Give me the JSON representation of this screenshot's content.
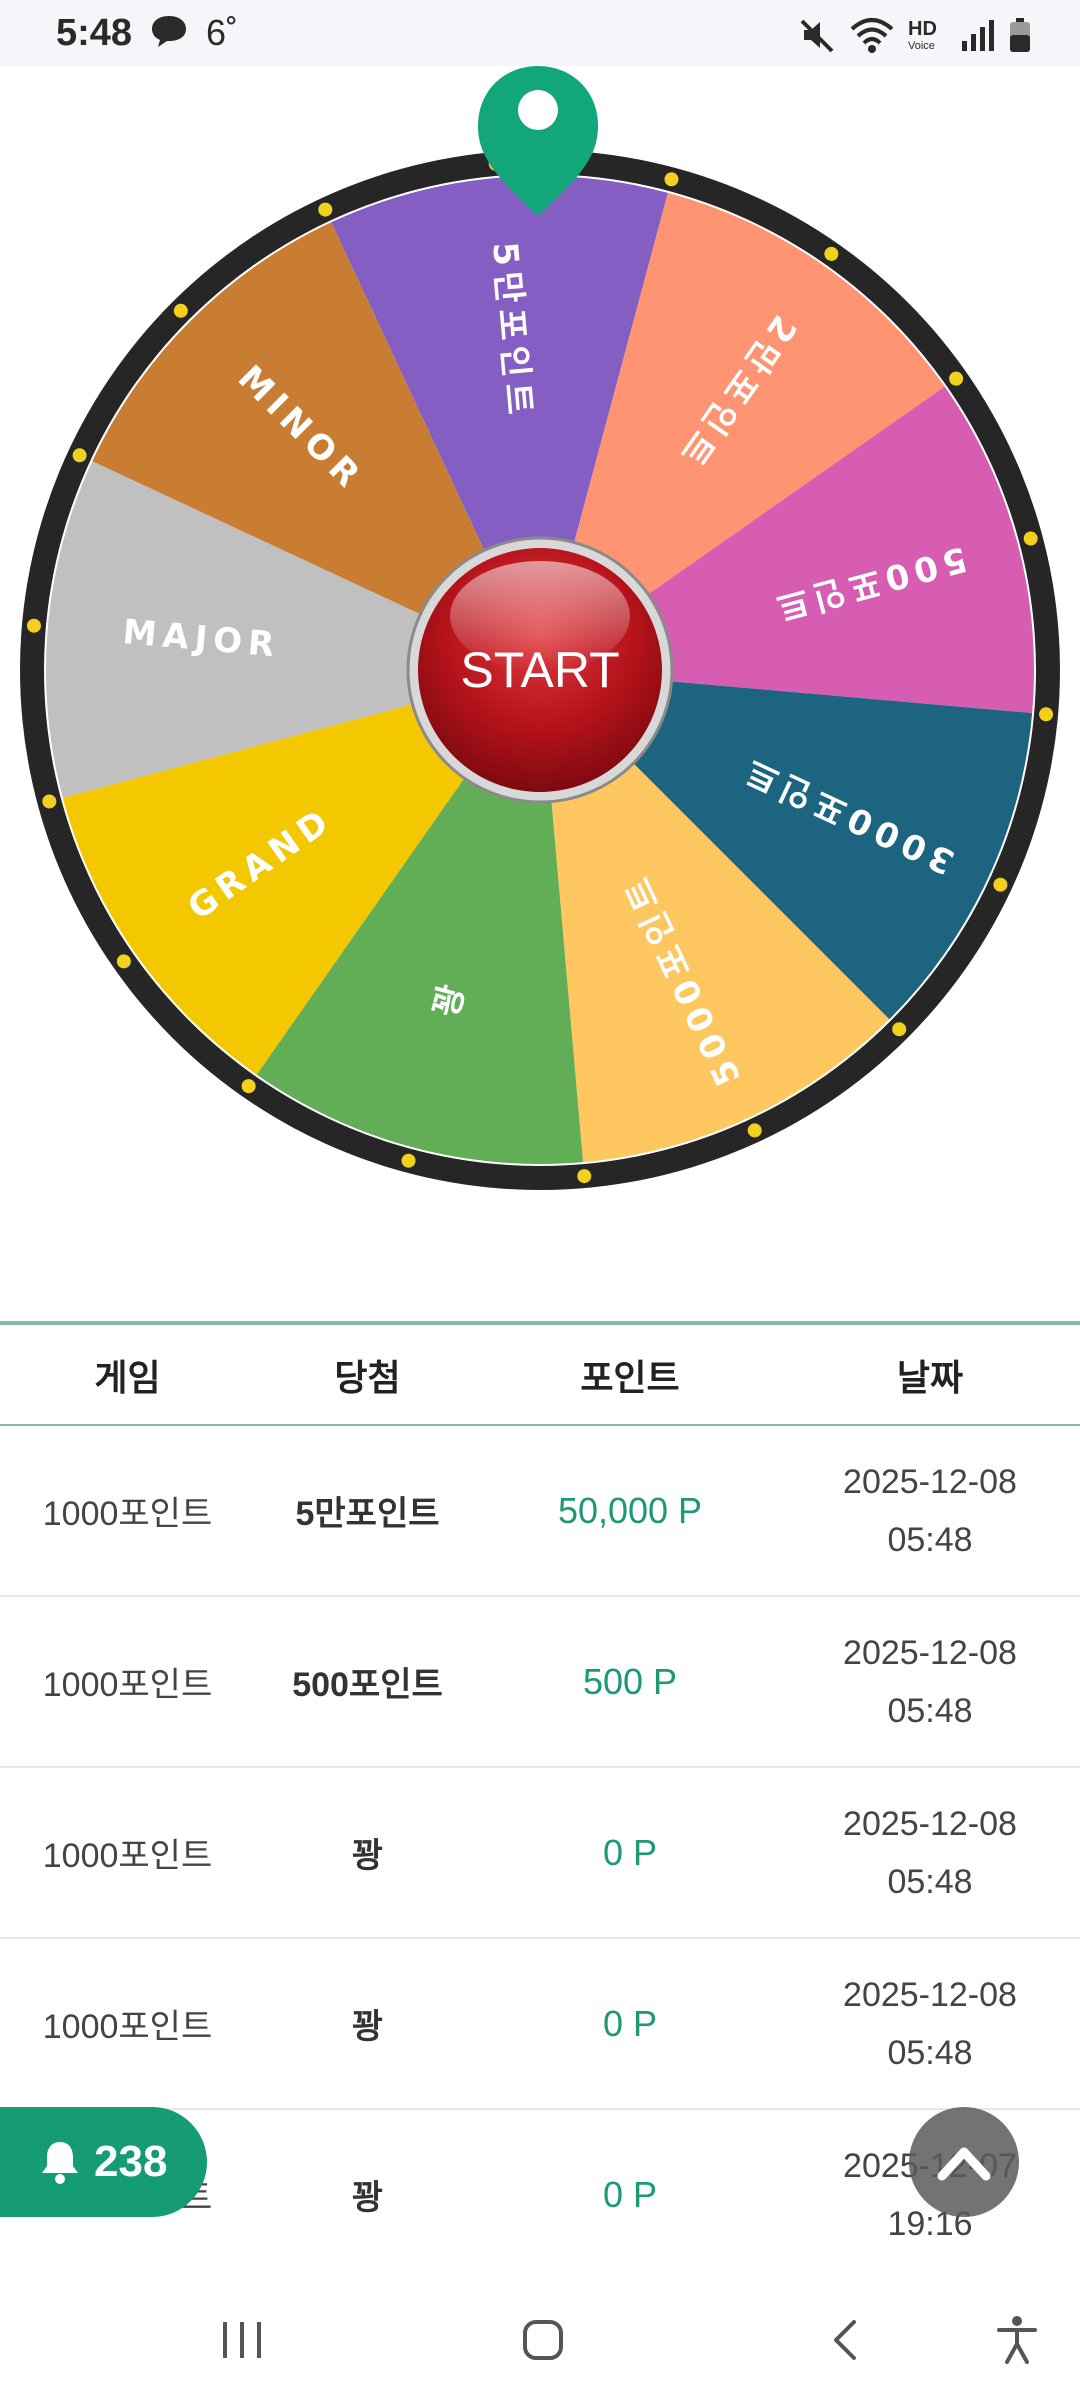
{
  "status": {
    "time": "5:48",
    "temperature": "6˚"
  },
  "wheel": {
    "start_label": "START",
    "segments": [
      {
        "label": "5만포인트",
        "color": "#845ec2"
      },
      {
        "label": "2만포인트",
        "color": "#ff9473"
      },
      {
        "label": "500포인트",
        "color": "#d65db1"
      },
      {
        "label": "3000포인트",
        "color": "#1c6480"
      },
      {
        "label": "5000포인트",
        "color": "#ffc75f"
      },
      {
        "label": "꽝",
        "color": "#62ae56"
      },
      {
        "label": "GRAND",
        "color": "#f3c800"
      },
      {
        "label": "MAJOR",
        "color": "#c0c0c0"
      },
      {
        "label": "MINOR",
        "color": "#c97d33"
      }
    ]
  },
  "history": {
    "headers": {
      "game": "게임",
      "prize": "당첨",
      "points": "포인트",
      "date": "날짜"
    },
    "rows": [
      {
        "game": "1000포인트",
        "prize": "5만포인트",
        "points": "50,000 P",
        "date": "2025-12-08",
        "time": "05:48"
      },
      {
        "game": "1000포인트",
        "prize": "500포인트",
        "points": "500 P",
        "date": "2025-12-08",
        "time": "05:48"
      },
      {
        "game": "1000포인트",
        "prize": "꽝",
        "points": "0 P",
        "date": "2025-12-08",
        "time": "05:48"
      },
      {
        "game": "1000포인트",
        "prize": "꽝",
        "points": "0 P",
        "date": "2025-12-08",
        "time": "05:48"
      },
      {
        "game": "1000포인트",
        "prize": "꽝",
        "points": "0 P",
        "date": "2025-12-07",
        "time": "19:16"
      }
    ]
  },
  "notifications": {
    "count": "238"
  },
  "colors": {
    "accent": "#159c75",
    "points": "#1d9a74",
    "table_border": "#8ab8a6"
  }
}
